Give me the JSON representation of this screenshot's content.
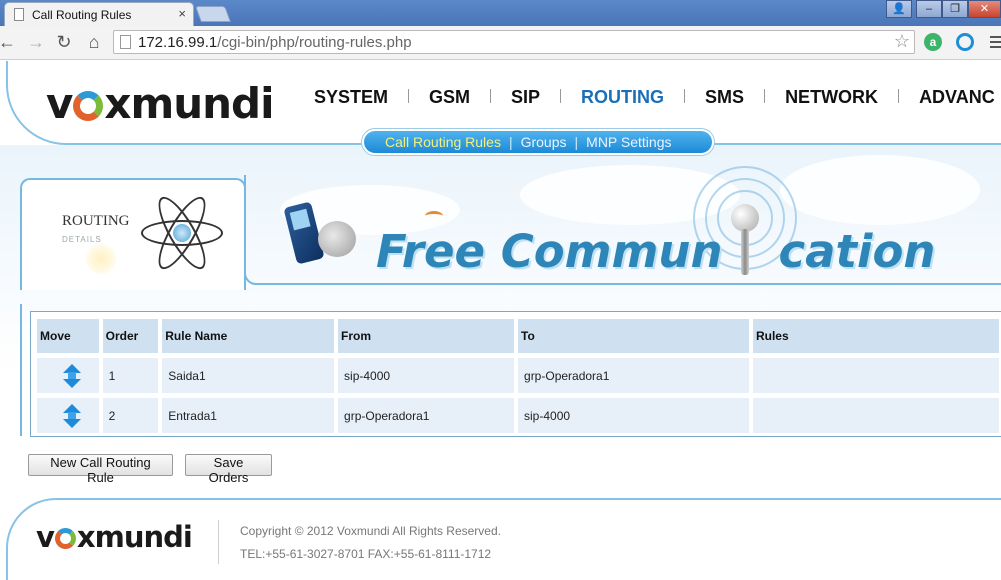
{
  "browser": {
    "tab_title": "Call Routing Rules",
    "tab_close": "×",
    "url_host": "172.16.99.1",
    "url_path": "/cgi-bin/php/routing-rules.php",
    "star": "☆",
    "back": "←",
    "forward": "→",
    "reload": "↻",
    "home": "⌂",
    "win_min": "–",
    "win_max": "❐",
    "win_close": "✕",
    "user_icon": "👤",
    "ext1": "a"
  },
  "brand": {
    "logo_pre": "v",
    "logo_post": "xmundi"
  },
  "nav": {
    "items": [
      "SYSTEM",
      "GSM",
      "SIP",
      "ROUTING",
      "SMS",
      "NETWORK",
      "ADVANC"
    ],
    "active": "ROUTING"
  },
  "subnav": {
    "items": [
      "Call Routing Rules",
      "Groups",
      "MNP Settings"
    ],
    "sep": "|",
    "active": "Call Routing Rules"
  },
  "section": {
    "title": "ROUTING",
    "subtitle": "DETAILS"
  },
  "banner": {
    "text_left": "Free Commun",
    "text_right": "cation"
  },
  "table": {
    "headers": [
      "Move",
      "Order",
      "Rule Name",
      "From",
      "To",
      "Rules"
    ],
    "rows": [
      {
        "order": "1",
        "rule_name": "Saida1",
        "from": "sip-4000",
        "to": "grp-Operadora1",
        "rules": ""
      },
      {
        "order": "2",
        "rule_name": "Entrada1",
        "from": "grp-Operadora1",
        "to": "sip-4000",
        "rules": ""
      }
    ]
  },
  "buttons": {
    "new_rule": "New Call Routing Rule",
    "save_orders": "Save Orders"
  },
  "footer": {
    "copyright": "Copyright © 2012 Voxmundi All Rights Reserved.",
    "contact": "TEL:+55-61-3027-8701 FAX:+55-61-8111-1712"
  },
  "colors": {
    "nav_active": "#1b6fb8",
    "subnav_active": "#f4f07a",
    "accent": "#2e86b8"
  }
}
